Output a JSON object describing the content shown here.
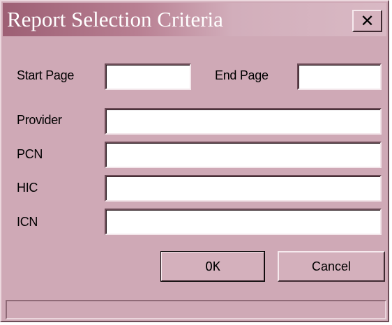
{
  "window": {
    "title": "Report Selection Criteria",
    "close_label": "✕"
  },
  "fields": {
    "start_page": {
      "label": "Start Page",
      "value": ""
    },
    "end_page": {
      "label": "End Page",
      "value": ""
    },
    "provider": {
      "label": "Provider",
      "value": ""
    },
    "pcn": {
      "label": "PCN",
      "value": ""
    },
    "hic": {
      "label": "HIC",
      "value": ""
    },
    "icn": {
      "label": "ICN",
      "value": ""
    }
  },
  "buttons": {
    "ok": "OK",
    "cancel": "Cancel"
  },
  "status": {
    "text": ""
  },
  "colors": {
    "background": "#cfa9b6",
    "title_start": "#9d5f74",
    "title_end": "#d9b9c4"
  }
}
